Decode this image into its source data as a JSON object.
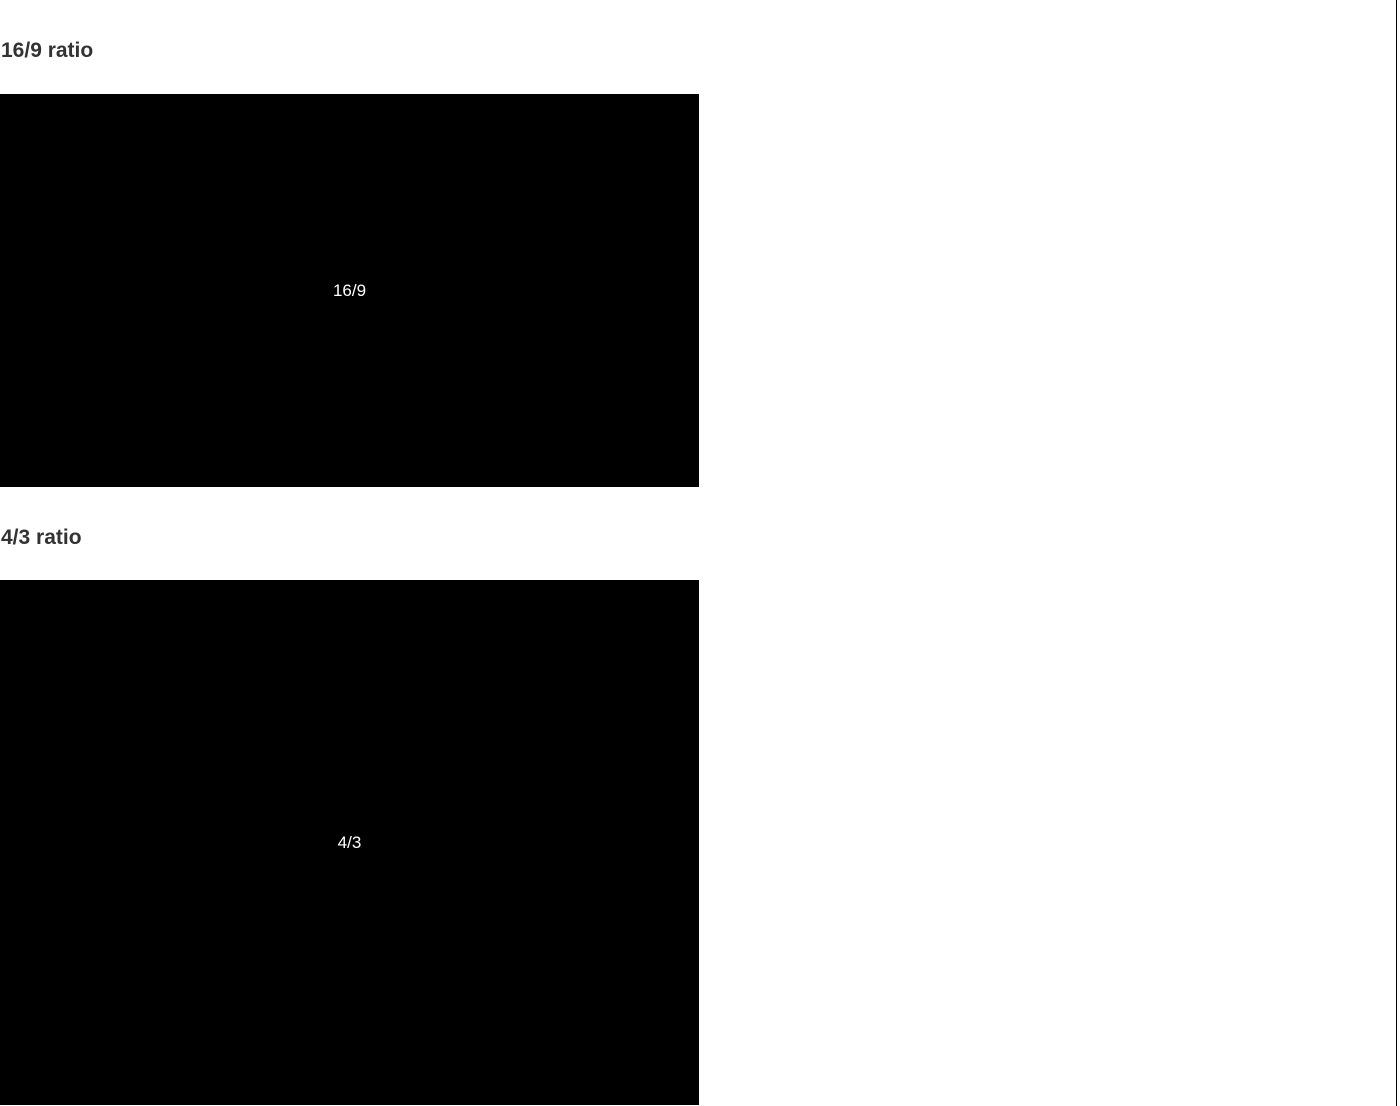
{
  "sections": [
    {
      "heading": "16/9 ratio",
      "box_label": "16/9"
    },
    {
      "heading": "4/3 ratio",
      "box_label": "4/3"
    }
  ],
  "colors": {
    "heading_text": "#333333",
    "box_background": "#000000",
    "box_text": "#ffffff",
    "page_background": "#ffffff"
  }
}
